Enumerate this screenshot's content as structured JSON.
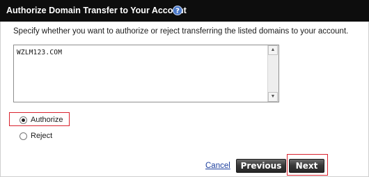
{
  "dialog": {
    "title": "Authorize Domain Transfer to Your Account",
    "instructions": "Specify whether you want to authorize or reject transferring the listed domains to your account."
  },
  "domains_textarea": {
    "value": "WZLM123.COM"
  },
  "options": {
    "authorize_label": "Authorize",
    "reject_label": "Reject",
    "selected": "Authorize"
  },
  "actions": {
    "cancel_label": "Cancel",
    "previous_label": "Previous",
    "next_label": "Next"
  },
  "icons": {
    "help": "help-icon",
    "scroll_up": "scroll-up-arrow-icon",
    "scroll_down": "scroll-down-arrow-icon"
  },
  "colors": {
    "titlebar": "#0d0d0d",
    "highlight": "#d9232e",
    "link": "#1d3f9e",
    "button": "#333333"
  }
}
